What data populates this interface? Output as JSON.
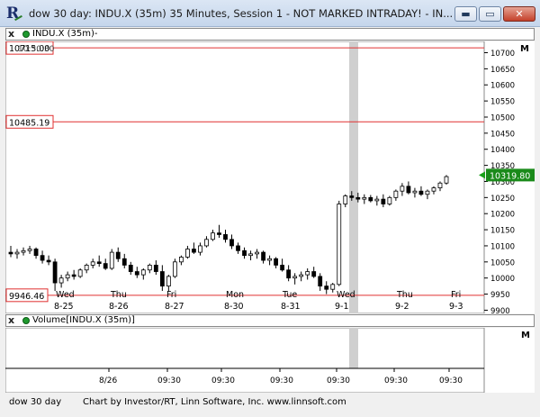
{
  "window": {
    "title": "dow 30 day: INDU.X (35m) 35 Minutes, Session 1 - NOT MARKED INTRADAY! - IN...",
    "minimize": "▬",
    "maximize": "▭",
    "close": "✕"
  },
  "price_pane": {
    "close_glyph": "x",
    "label": "INDU.X (35m)-",
    "hidden_label": "10:30:30",
    "last_price": "10319.80",
    "marker_glyph": "M"
  },
  "volume_pane": {
    "close_glyph": "x",
    "label": "Volume[INDU.X (35m)]",
    "marker_glyph": "M"
  },
  "footer": {
    "chart_name": "dow 30 day",
    "credit": "Chart by Investor/RT, Linn Software, Inc. www.linnsoft.com"
  },
  "colors": {
    "level_line": "#e03030",
    "last_price_bg": "#1a8a1a",
    "highlight_band": "#cccccc"
  },
  "chart_data": {
    "type": "bar",
    "instrument": "INDU.X (35m)",
    "y_ticks": [
      9900,
      9950,
      10000,
      10050,
      10100,
      10150,
      10200,
      10250,
      10300,
      10350,
      10400,
      10450,
      10500,
      10550,
      10600,
      10650,
      10700
    ],
    "ylim": [
      9890,
      10735
    ],
    "level_lines": [
      {
        "value": 10715.0,
        "label": "10715.00"
      },
      {
        "value": 10485.19,
        "label": "10485.19"
      },
      {
        "value": 9946.46,
        "label": "9946.46"
      }
    ],
    "day_labels": [
      {
        "day": "Wed",
        "date": "8-25"
      },
      {
        "day": "Thu",
        "date": "8-26"
      },
      {
        "day": "Fri",
        "date": "8-27"
      },
      {
        "day": "Mon",
        "date": "8-30"
      },
      {
        "day": "Tue",
        "date": "8-31"
      },
      {
        "day": "Wed",
        "date": "9-1"
      },
      {
        "day": "Thu",
        "date": "9-2"
      },
      {
        "day": "Fri",
        "date": "9-3"
      }
    ],
    "volume_time_labels": [
      "8/26",
      "09:30",
      "09:30",
      "09:30",
      "09:30",
      "09:30",
      "09:30"
    ],
    "bars": [
      [
        10080,
        10100,
        10065,
        10075
      ],
      [
        10075,
        10090,
        10060,
        10080
      ],
      [
        10080,
        10095,
        10070,
        10085
      ],
      [
        10085,
        10100,
        10075,
        10090
      ],
      [
        10090,
        10095,
        10060,
        10070
      ],
      [
        10070,
        10085,
        10045,
        10055
      ],
      [
        10055,
        10070,
        10040,
        10050
      ],
      [
        10050,
        10060,
        9960,
        9985
      ],
      [
        9985,
        10010,
        9970,
        10000
      ],
      [
        10000,
        10020,
        9990,
        10010
      ],
      [
        10010,
        10025,
        9995,
        10005
      ],
      [
        10005,
        10030,
        10000,
        10025
      ],
      [
        10025,
        10045,
        10015,
        10040
      ],
      [
        10040,
        10060,
        10030,
        10050
      ],
      [
        10050,
        10070,
        10035,
        10045
      ],
      [
        10045,
        10060,
        10025,
        10030
      ],
      [
        10030,
        10090,
        10025,
        10080
      ],
      [
        10080,
        10095,
        10050,
        10060
      ],
      [
        10060,
        10075,
        10030,
        10040
      ],
      [
        10040,
        10050,
        10010,
        10020
      ],
      [
        10020,
        10035,
        10000,
        10010
      ],
      [
        10010,
        10030,
        9995,
        10025
      ],
      [
        10025,
        10045,
        10015,
        10040
      ],
      [
        10040,
        10055,
        10010,
        10020
      ],
      [
        10020,
        10040,
        9960,
        9975
      ],
      [
        9975,
        10010,
        9960,
        10005
      ],
      [
        10005,
        10060,
        10000,
        10050
      ],
      [
        10050,
        10070,
        10040,
        10065
      ],
      [
        10065,
        10100,
        10060,
        10090
      ],
      [
        10090,
        10110,
        10075,
        10080
      ],
      [
        10080,
        10110,
        10070,
        10100
      ],
      [
        10100,
        10130,
        10095,
        10120
      ],
      [
        10120,
        10150,
        10115,
        10140
      ],
      [
        10140,
        10165,
        10125,
        10135
      ],
      [
        10135,
        10150,
        10110,
        10120
      ],
      [
        10120,
        10135,
        10090,
        10100
      ],
      [
        10100,
        10110,
        10075,
        10085
      ],
      [
        10085,
        10095,
        10060,
        10070
      ],
      [
        10070,
        10085,
        10055,
        10075
      ],
      [
        10075,
        10090,
        10060,
        10080
      ],
      [
        10080,
        10085,
        10045,
        10055
      ],
      [
        10055,
        10070,
        10040,
        10060
      ],
      [
        10060,
        10065,
        10030,
        10040
      ],
      [
        10040,
        10060,
        10020,
        10025
      ],
      [
        10025,
        10040,
        9990,
        10000
      ],
      [
        10000,
        10015,
        9980,
        10005
      ],
      [
        10005,
        10020,
        9990,
        10010
      ],
      [
        10010,
        10030,
        9995,
        10020
      ],
      [
        10020,
        10035,
        10000,
        10005
      ],
      [
        10005,
        10015,
        9960,
        9975
      ],
      [
        9975,
        9990,
        9950,
        9965
      ],
      [
        9965,
        9985,
        9955,
        9980
      ],
      [
        9980,
        10240,
        9975,
        10230
      ],
      [
        10230,
        10260,
        10220,
        10255
      ],
      [
        10255,
        10270,
        10240,
        10250
      ],
      [
        10250,
        10265,
        10235,
        10245
      ],
      [
        10245,
        10260,
        10230,
        10250
      ],
      [
        10250,
        10258,
        10235,
        10240
      ],
      [
        10240,
        10255,
        10225,
        10245
      ],
      [
        10245,
        10260,
        10220,
        10230
      ],
      [
        10230,
        10255,
        10225,
        10250
      ],
      [
        10250,
        10275,
        10240,
        10270
      ],
      [
        10270,
        10295,
        10255,
        10285
      ],
      [
        10285,
        10300,
        10260,
        10265
      ],
      [
        10265,
        10280,
        10250,
        10270
      ],
      [
        10270,
        10285,
        10255,
        10260
      ],
      [
        10260,
        10275,
        10245,
        10270
      ],
      [
        10270,
        10285,
        10260,
        10280
      ],
      [
        10280,
        10300,
        10270,
        10295
      ],
      [
        10295,
        10320,
        10290,
        10315
      ]
    ]
  }
}
